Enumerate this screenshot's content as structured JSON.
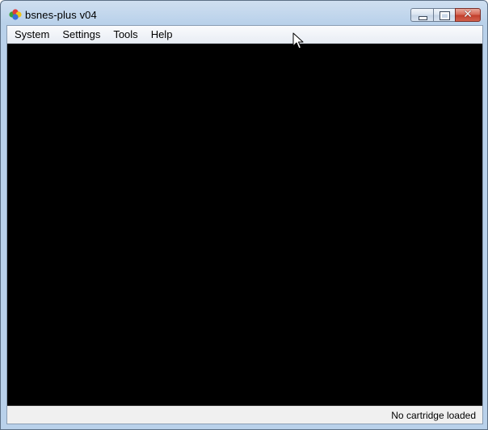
{
  "window": {
    "title": "bsnes-plus v04",
    "app_icon": "bsnes-logo-icon",
    "caption_buttons": {
      "minimize_icon": "minimize-icon",
      "maximize_icon": "maximize-icon",
      "close_icon": "close-icon",
      "close_glyph": "✕"
    }
  },
  "menubar": {
    "items": [
      {
        "label": "System"
      },
      {
        "label": "Settings"
      },
      {
        "label": "Tools"
      },
      {
        "label": "Help"
      }
    ]
  },
  "screen": {
    "background": "#000000"
  },
  "statusbar": {
    "text": "No cartridge loaded"
  },
  "colors": {
    "frame": "#b9d1ea",
    "close_button": "#c2402d",
    "screen": "#000000"
  }
}
